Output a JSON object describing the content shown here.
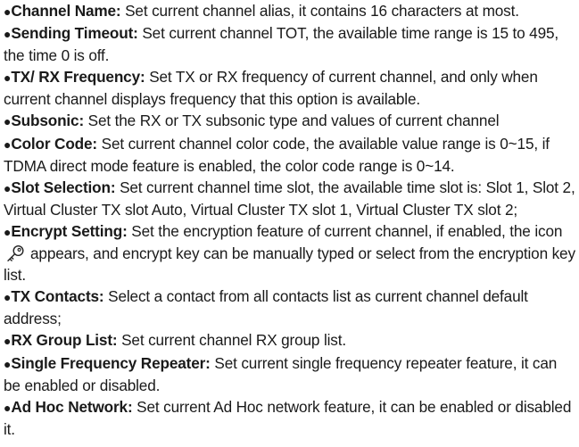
{
  "bullet": "●",
  "items": [
    {
      "term": "Channel Name:",
      "desc": " Set current channel alias, it contains 16 characters at most."
    },
    {
      "term": "Sending Timeout:",
      "desc": " Set current channel TOT, the available time range is 15 to 495, the time 0 is off."
    },
    {
      "term": "TX/ RX Frequency:",
      "desc": " Set TX or RX frequency of current channel, and only when current channel displays frequency that this option is available."
    },
    {
      "term": "Subsonic:",
      "desc": " Set the RX or TX subsonic type and values of current channel"
    },
    {
      "term": "Color Code:",
      "desc": " Set current channel color code, the available value range is 0~15, if TDMA direct mode feature is enabled, the color code range is 0~14."
    },
    {
      "term": "Slot Selection:",
      "desc": " Set current channel time slot, the available time slot is: Slot 1, Slot 2, Virtual Cluster TX slot Auto, Virtual Cluster TX slot 1, Virtual Cluster TX slot 2;"
    },
    {
      "term": "Encrypt Setting:",
      "desc_before_icon": " Set the encryption feature of current channel, if enabled, the icon",
      "icon": "key-icon",
      "desc_after_icon": "appears, and encrypt key can be manually typed or select from the encryption key list."
    },
    {
      "term": "TX Contacts:",
      "desc": " Select a contact from all contacts list as current channel default address;"
    },
    {
      "term": "RX Group List:",
      "desc": " Set current channel RX group list."
    },
    {
      "term": "Single Frequency Repeater:",
      "desc": " Set current single frequency repeater feature, it can be enabled or disabled."
    },
    {
      "term": "Ad Hoc Network:",
      "desc": " Set current Ad Hoc network feature, it can be enabled or disabled it."
    }
  ]
}
